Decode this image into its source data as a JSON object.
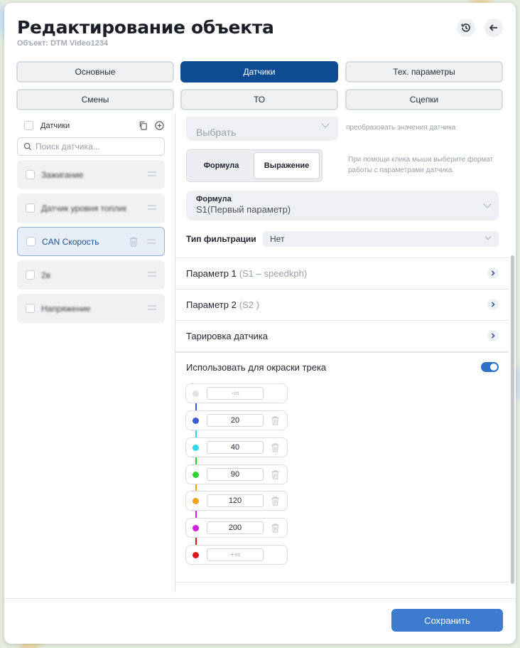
{
  "header": {
    "title": "Редактирование объекта",
    "subtitle": "Объект: DTM Video1234"
  },
  "tabs": [
    {
      "label": "Основные"
    },
    {
      "label": "Датчики"
    },
    {
      "label": "Тех. параметры"
    },
    {
      "label": "Смены"
    },
    {
      "label": "ТО"
    },
    {
      "label": "Сцепки"
    }
  ],
  "active_tab": "Датчики",
  "left": {
    "header_label": "Датчики",
    "search_placeholder": "Поиск датчика...",
    "sensors": [
      {
        "name": "Зажигание"
      },
      {
        "name": "Датчик уровня топлива"
      },
      {
        "name": "CAN Скорость"
      },
      {
        "name": "2в"
      },
      {
        "name": "Напряжение"
      }
    ],
    "selected_sensor": "CAN Скорость"
  },
  "right": {
    "select_placeholder": "Выбрать",
    "select_hint": "преобразовать значения датчика",
    "mode": {
      "options": [
        "Формула",
        "Выражение"
      ],
      "hint": "При помощи клика мыши выберите формат работы с параметрами датчика."
    },
    "formula": {
      "label": "Формула",
      "value": "S1(Первый параметр)"
    },
    "filter": {
      "label": "Тип фильтрации",
      "value": "Нет"
    },
    "rows": [
      {
        "label": "Параметр 1",
        "muted": "(S1 – speedkph)"
      },
      {
        "label": "Параметр 2",
        "muted": "(S2 )"
      },
      {
        "label": "Тарировка датчика",
        "muted": ""
      }
    ],
    "track": {
      "title": "Использовать для окраски трека",
      "enabled": true,
      "steps": [
        {
          "value": "-∞",
          "color": "#dfe1e4"
        },
        {
          "value": "20",
          "color": "#3b5bd6"
        },
        {
          "value": "40",
          "color": "#2fd8e8"
        },
        {
          "value": "90",
          "color": "#2ed22e"
        },
        {
          "value": "120",
          "color": "#f2a21a"
        },
        {
          "value": "200",
          "color": "#d51fe0"
        },
        {
          "value": "+∞",
          "color": "#e2131b"
        }
      ]
    }
  },
  "footer": {
    "save_label": "Сохранить"
  }
}
